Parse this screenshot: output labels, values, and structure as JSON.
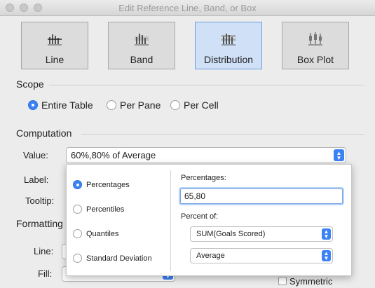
{
  "window": {
    "title": "Edit Reference Line, Band, or Box"
  },
  "types": [
    {
      "label": "Line",
      "icon": "line-chart-icon"
    },
    {
      "label": "Band",
      "icon": "band-chart-icon"
    },
    {
      "label": "Distribution",
      "icon": "distribution-chart-icon",
      "selected": true
    },
    {
      "label": "Box Plot",
      "icon": "box-plot-icon"
    }
  ],
  "scope": {
    "heading": "Scope",
    "options": [
      "Entire Table",
      "Per Pane",
      "Per Cell"
    ],
    "selected": "Entire Table"
  },
  "computation": {
    "heading": "Computation",
    "value_label": "Value:",
    "value": "60%,80% of Average",
    "label_label": "Label:",
    "tooltip_label": "Tooltip:"
  },
  "formatting": {
    "heading": "Formatting",
    "line_label": "Line:",
    "fill_label": "Fill:",
    "symmetric_label": "Symmetric"
  },
  "popup": {
    "options": [
      "Percentages",
      "Percentiles",
      "Quantiles",
      "Standard Deviation"
    ],
    "selected": "Percentages",
    "percentages_label": "Percentages:",
    "percentages_value": "65,80",
    "percent_of_label": "Percent of:",
    "measure": "SUM(Goals Scored)",
    "aggregation": "Average"
  },
  "colors": {
    "accent": "#3b82f6",
    "selected_button_bg": "#cfe0f7"
  }
}
